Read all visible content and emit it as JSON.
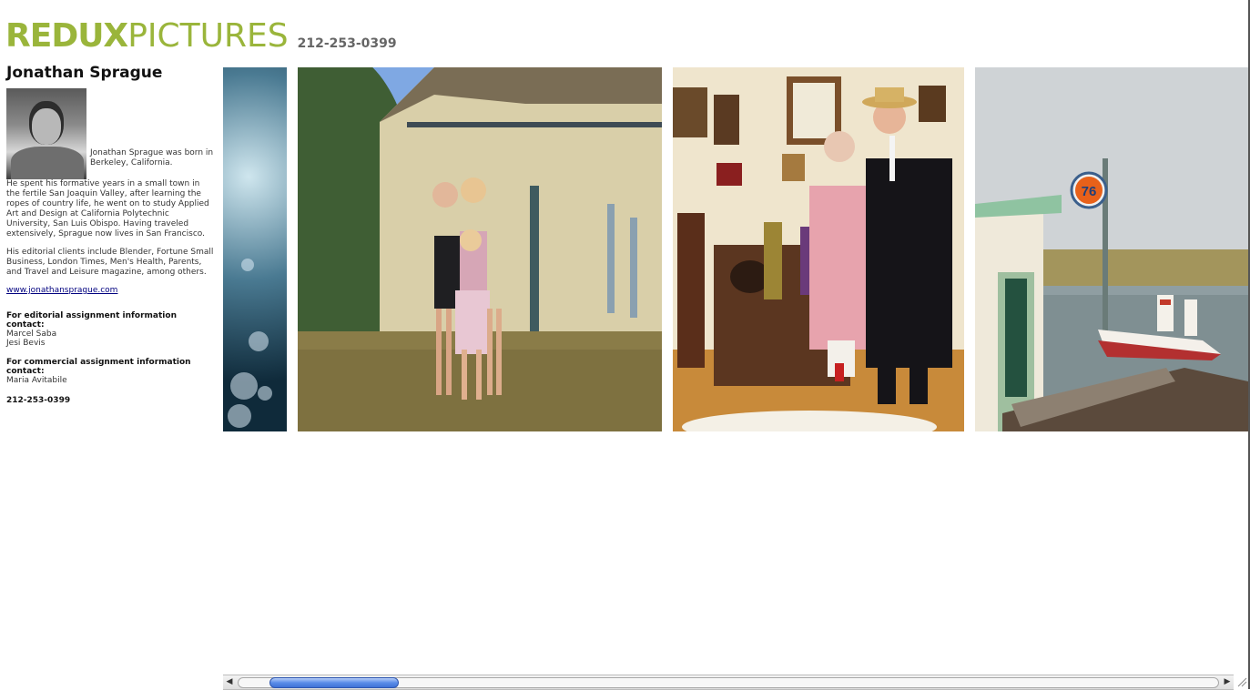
{
  "brand": {
    "logo_bold": "REDUX",
    "logo_light": "PICTURES",
    "phone": "212-253-0399",
    "accent_color": "#9ab53b"
  },
  "photographer": {
    "name": "Jonathan Sprague",
    "bio_intro": "Jonathan Sprague was born in Berkeley, California.",
    "bio_p1": "He spent his formative years in a small town in the fertile San Joaquin Valley, after learning the ropes of country life, he went on to study Applied Art and Design at California Polytechnic University, San Luis Obispo. Having traveled extensively, Sprague now lives in San Francisco.",
    "bio_p2": "His editorial clients include Blender, Fortune Small Business, London Times, Men's Health, Parents, and Travel and Leisure magazine, among others.",
    "website": "www.jonathansprague.com"
  },
  "contacts": {
    "editorial_heading": "For editorial assignment information contact:",
    "editorial_names": [
      "Marcel Saba",
      "Jesi Bevis"
    ],
    "commercial_heading": "For commercial assignment information contact:",
    "commercial_names": [
      "Maria Avitabile"
    ],
    "phone": "212-253-0399"
  },
  "gallery": {
    "gas_sign_number": "76"
  },
  "scroll": {
    "horizontal_position_fraction": 0.03
  }
}
